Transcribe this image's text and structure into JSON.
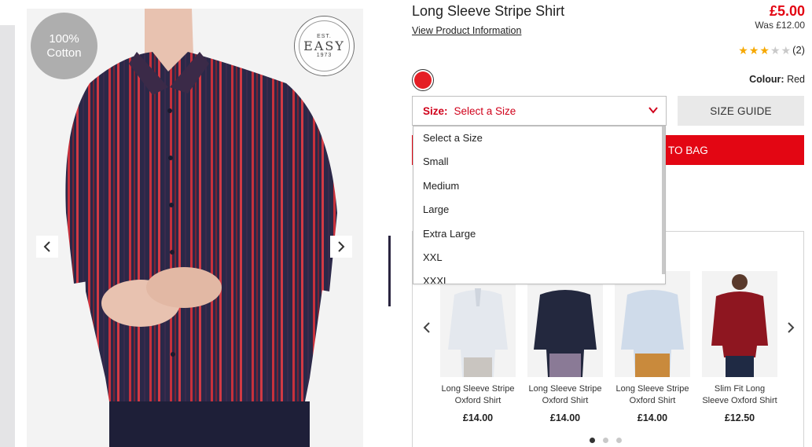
{
  "product": {
    "title": "Long Sleeve Stripe Shirt",
    "view_info_link": "View Product Information",
    "price": "£5.00",
    "was_price": "Was £12.00",
    "rating": {
      "stars_filled": 3,
      "stars_total": 5,
      "review_count": "(2)"
    },
    "colour_label": "Colour:",
    "colour_value": "Red",
    "swatch_color": "#e51e25"
  },
  "gallery": {
    "badge_line1": "100%",
    "badge_line2": "Cotton",
    "logo": {
      "est": "EST.",
      "word": "EASY",
      "year": "1973"
    },
    "prev_arrow_icon": "chevron-left-icon",
    "next_arrow_icon": "chevron-right-icon"
  },
  "size_select": {
    "label": "Size:",
    "value": "Select a Size",
    "options": [
      "Select a Size",
      "Small",
      "Medium",
      "Large",
      "Extra Large",
      "XXL",
      "XXXL"
    ]
  },
  "buttons": {
    "size_guide": "SIZE GUIDE",
    "add_to_bag": "TO BAG"
  },
  "recommendations": {
    "items": [
      {
        "name": "Long Sleeve Stripe Oxford Shirt",
        "price": "£14.00"
      },
      {
        "name": "Long Sleeve Stripe Oxford Shirt",
        "price": "£14.00"
      },
      {
        "name": "Long Sleeve Stripe Oxford Shirt",
        "price": "£14.00"
      },
      {
        "name": "Slim Fit Long Sleeve Oxford Shirt",
        "price": "£12.50"
      }
    ],
    "page_count": 3,
    "active_page": 1
  },
  "colors": {
    "accent_red": "#e30613",
    "select_text": "#d0021b",
    "star_filled": "#f6a800",
    "star_empty": "#c9c9c9"
  }
}
